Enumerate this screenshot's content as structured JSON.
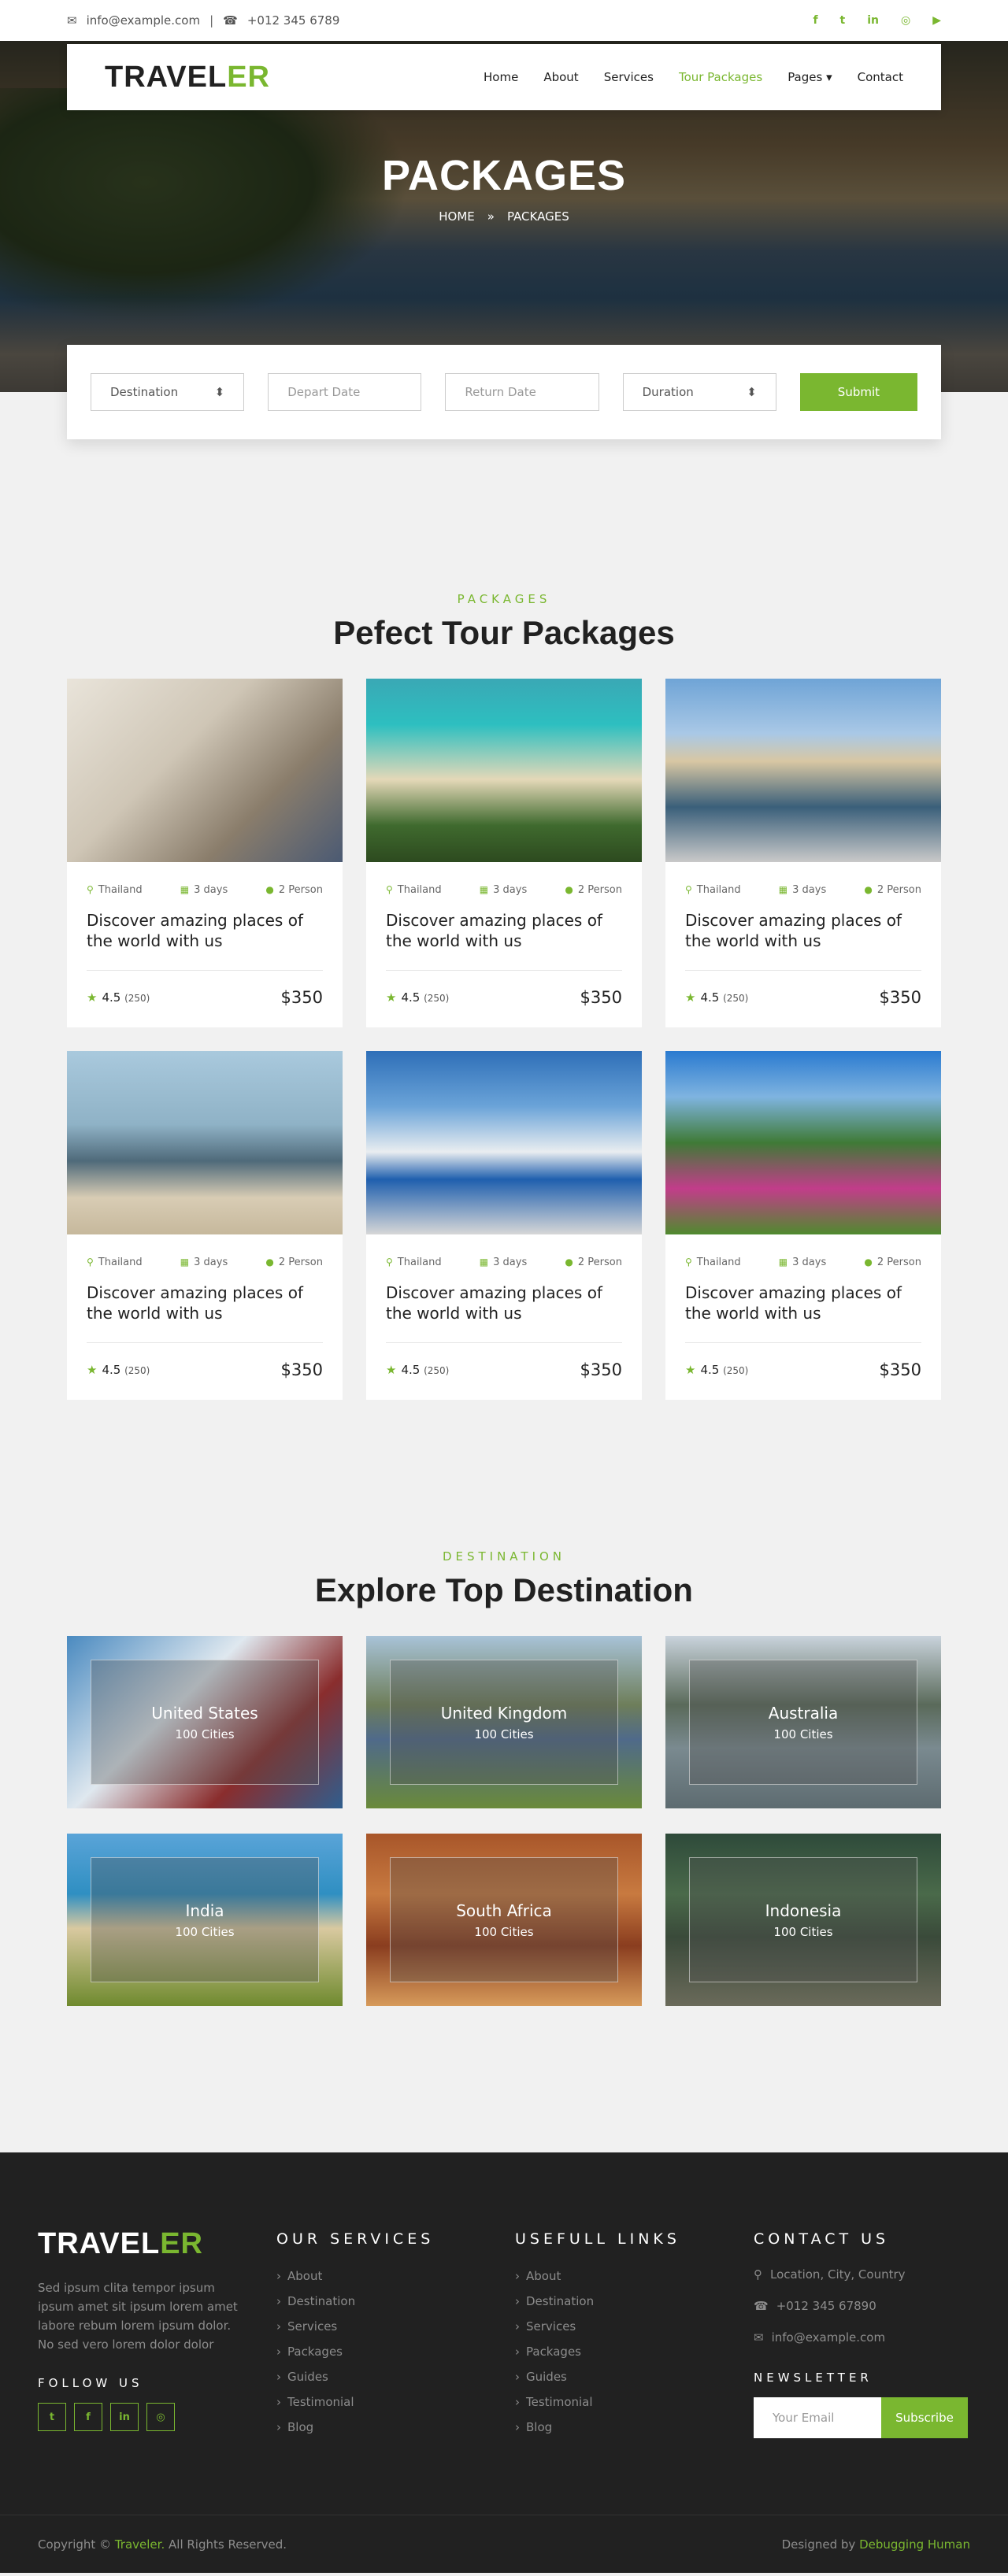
{
  "topbar": {
    "email": "info@example.com",
    "phone": "+012 345 6789",
    "socials": [
      "facebook-icon",
      "twitter-icon",
      "linkedin-icon",
      "instagram-icon",
      "youtube-icon"
    ]
  },
  "brand": {
    "name_main": "TRAVEL",
    "name_accent": "ER",
    "accent_color": "#7ab730"
  },
  "nav": {
    "items": [
      "Home",
      "About",
      "Services",
      "Tour Packages",
      "Pages",
      "Contact"
    ],
    "active": "Tour Packages"
  },
  "hero": {
    "title": "PACKAGES",
    "crumb_home": "HOME",
    "crumb_sep": "»",
    "crumb_current": "PACKAGES"
  },
  "booking": {
    "destination": "Destination",
    "depart_placeholder": "Depart Date",
    "return_placeholder": "Return Date",
    "duration": "Duration",
    "submit": "Submit"
  },
  "packages": {
    "eyebrow": "PACKAGES",
    "title": "Pefect Tour Packages",
    "items": [
      {
        "location": "Thailand",
        "days": "3 days",
        "persons": "2 Person",
        "title": "Discover amazing places of the world with us",
        "rating": "4.5",
        "reviews": "(250)",
        "price": "$350"
      },
      {
        "location": "Thailand",
        "days": "3 days",
        "persons": "2 Person",
        "title": "Discover amazing places of the world with us",
        "rating": "4.5",
        "reviews": "(250)",
        "price": "$350"
      },
      {
        "location": "Thailand",
        "days": "3 days",
        "persons": "2 Person",
        "title": "Discover amazing places of the world with us",
        "rating": "4.5",
        "reviews": "(250)",
        "price": "$350"
      },
      {
        "location": "Thailand",
        "days": "3 days",
        "persons": "2 Person",
        "title": "Discover amazing places of the world with us",
        "rating": "4.5",
        "reviews": "(250)",
        "price": "$350"
      },
      {
        "location": "Thailand",
        "days": "3 days",
        "persons": "2 Person",
        "title": "Discover amazing places of the world with us",
        "rating": "4.5",
        "reviews": "(250)",
        "price": "$350"
      },
      {
        "location": "Thailand",
        "days": "3 days",
        "persons": "2 Person",
        "title": "Discover amazing places of the world with us",
        "rating": "4.5",
        "reviews": "(250)",
        "price": "$350"
      }
    ]
  },
  "destinations": {
    "eyebrow": "DESTINATION",
    "title": "Explore Top Destination",
    "items": [
      {
        "name": "United States",
        "cities": "100 Cities"
      },
      {
        "name": "United Kingdom",
        "cities": "100 Cities"
      },
      {
        "name": "Australia",
        "cities": "100 Cities"
      },
      {
        "name": "India",
        "cities": "100 Cities"
      },
      {
        "name": "South Africa",
        "cities": "100 Cities"
      },
      {
        "name": "Indonesia",
        "cities": "100 Cities"
      }
    ]
  },
  "footer": {
    "about": "Sed ipsum clita tempor ipsum ipsum amet sit ipsum lorem amet labore rebum lorem ipsum dolor. No sed vero lorem dolor dolor",
    "follow_title": "FOLLOW US",
    "services_title": "OUR SERVICES",
    "services": [
      "About",
      "Destination",
      "Services",
      "Packages",
      "Guides",
      "Testimonial",
      "Blog"
    ],
    "links_title": "USEFULL LINKS",
    "links": [
      "About",
      "Destination",
      "Services",
      "Packages",
      "Guides",
      "Testimonial",
      "Blog"
    ],
    "contact_title": "CONTACT US",
    "address": "Location, City, Country",
    "phone": "+012 345 67890",
    "email": "info@example.com",
    "newsletter_title": "NEWSLETTER",
    "newsletter_placeholder": "Your Email",
    "subscribe": "Subscribe",
    "copyright_pre": "Copyright ©",
    "copyright_brand": "Traveler.",
    "copyright_post": "All Rights Reserved.",
    "designed_pre": "Designed by",
    "designed_by": "Debugging Human"
  }
}
